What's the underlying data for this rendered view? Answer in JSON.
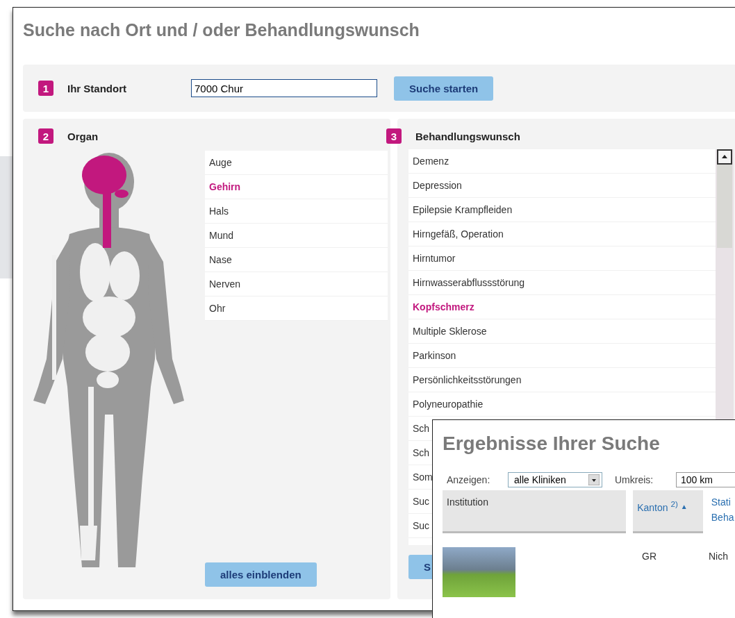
{
  "search_page": {
    "title": "Suche nach Ort und / oder Behandlungswunsch",
    "location": {
      "step": "1",
      "label": "Ihr Standort",
      "value": "7000 Chur",
      "button": "Suche starten"
    },
    "organ": {
      "step": "2",
      "label": "Organ",
      "items": [
        {
          "label": "Auge",
          "selected": false
        },
        {
          "label": "Gehirn",
          "selected": true
        },
        {
          "label": "Hals",
          "selected": false
        },
        {
          "label": "Mund",
          "selected": false
        },
        {
          "label": "Nase",
          "selected": false
        },
        {
          "label": "Nerven",
          "selected": false
        },
        {
          "label": "Ohr",
          "selected": false
        }
      ],
      "button": "alles einblenden"
    },
    "treatment": {
      "step": "3",
      "label": "Behandlungswunsch",
      "items": [
        {
          "label": "Demenz",
          "selected": false
        },
        {
          "label": "Depression",
          "selected": false
        },
        {
          "label": "Epilepsie Krampfleiden",
          "selected": false
        },
        {
          "label": "Hirngefäß, Operation",
          "selected": false
        },
        {
          "label": "Hirntumor",
          "selected": false
        },
        {
          "label": "Hirnwasserabflussstörung",
          "selected": false
        },
        {
          "label": "Kopfschmerz",
          "selected": true
        },
        {
          "label": "Multiple Sklerose",
          "selected": false
        },
        {
          "label": "Parkinson",
          "selected": false
        },
        {
          "label": "Persönlichkeitsstörungen",
          "selected": false
        },
        {
          "label": "Polyneuropathie",
          "selected": false
        },
        {
          "label": "Sch",
          "selected": false
        },
        {
          "label": "Sch",
          "selected": false
        },
        {
          "label": "Som",
          "selected": false
        },
        {
          "label": "Suc",
          "selected": false
        },
        {
          "label": "Suc",
          "selected": false
        }
      ],
      "button": "S"
    }
  },
  "results_window": {
    "title": "Ergebnisse Ihrer Suche",
    "filters": {
      "show_label": "Anzeigen:",
      "show_value": "alle Kliniken",
      "radius_label": "Umkreis:",
      "radius_value": "100 km"
    },
    "columns": [
      {
        "lines": [
          "Institution"
        ],
        "link": false
      },
      {
        "lines": [
          "Kanton $^{2)}$"
        ],
        "link": true,
        "sort": "▲"
      },
      {
        "lines": [
          "Stati",
          "Beha"
        ],
        "link": true
      }
    ],
    "rows": [
      {
        "cells": [
          "",
          "GR",
          "Nich"
        ]
      }
    ]
  }
}
